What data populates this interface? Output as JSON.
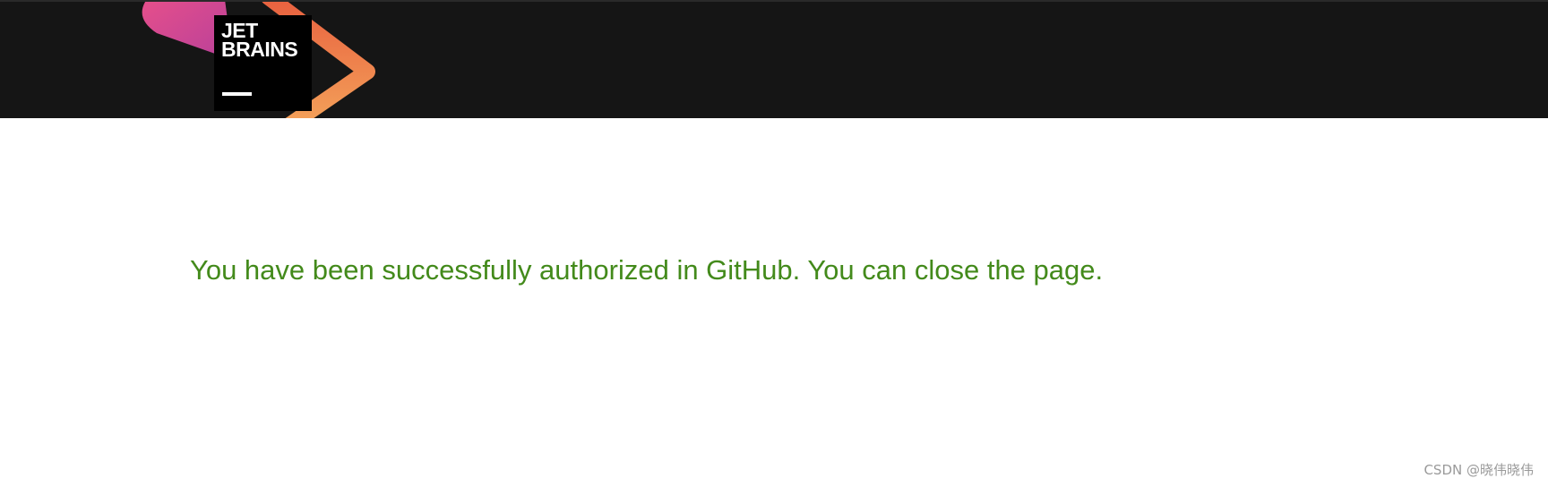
{
  "header": {
    "logo": {
      "line1": "JET",
      "line2": "BRAINS",
      "icon": "jetbrains-logo",
      "colors": {
        "pink": "#d8408f",
        "magenta": "#b8409a",
        "orange": "#ea6f3b",
        "light_orange": "#f4a35a",
        "box": "#000000",
        "header_bg": "#151515"
      }
    }
  },
  "main": {
    "message": "You have been successfully authorized in GitHub. You can close the page.",
    "message_color": "#438a1b"
  },
  "watermark": {
    "text": "CSDN @晓伟晓伟"
  }
}
